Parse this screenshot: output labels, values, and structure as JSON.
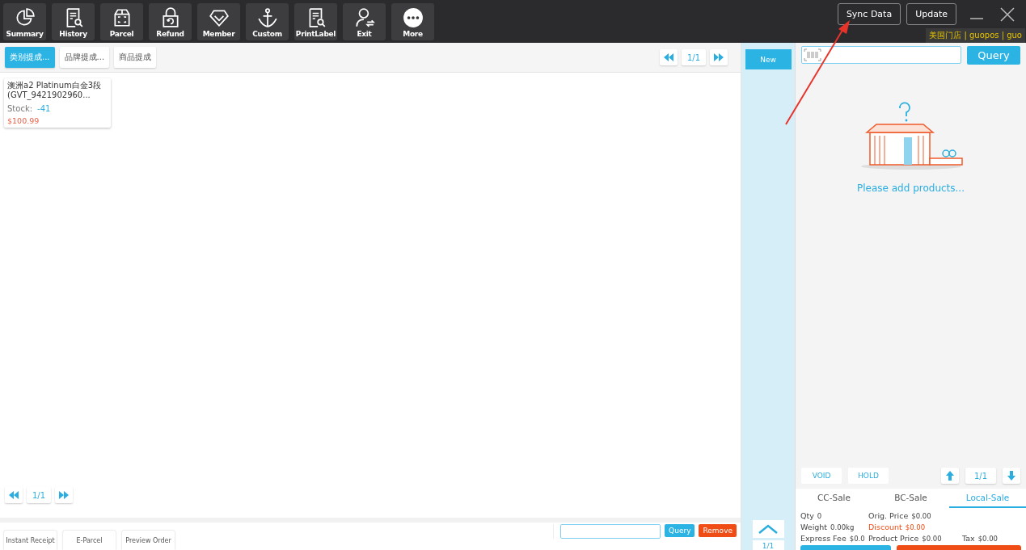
{
  "toolbar": [
    "Summary",
    "History",
    "Parcel",
    "Refund",
    "Member",
    "Custom",
    "PrintLabel",
    "Exit",
    "More"
  ],
  "header_buttons": [
    "Sync Data",
    "Update"
  ],
  "store_info": "美国门店 | guopos | guo",
  "category_tabs": [
    {
      "label": "类别提成...",
      "selected": true
    },
    {
      "label": "品牌提成...",
      "selected": false
    },
    {
      "label": "商品提成",
      "selected": false
    }
  ],
  "top_pager": "1/1",
  "products": [
    {
      "name": "澳洲a2 Platinum白金3段(GVT_9421902960...",
      "stock_label": "Stock:",
      "stock": "-41",
      "price": "$100.99"
    }
  ],
  "bottom_pager": "1/1",
  "bottom_buttons": [
    "Instant Receipt",
    "E-Parcel",
    "Preview Order"
  ],
  "order_search": {
    "query": "Query",
    "remove": "Remove"
  },
  "new_button": "New",
  "side_pager": "1/1",
  "cart": {
    "search_button": "Query",
    "empty_message": "Please add products...",
    "void": "VOID",
    "hold": "HOLD",
    "pager": "1/1"
  },
  "sale_tabs": [
    {
      "label": "CC-Sale",
      "selected": false
    },
    {
      "label": "BC-Sale",
      "selected": false
    },
    {
      "label": "Local-Sale",
      "selected": true
    }
  ],
  "totals": [
    [
      {
        "label": "Qty",
        "value": "0",
        "kind": "plain"
      },
      {
        "label": "Orig. Price",
        "value": "$0.00",
        "kind": "plain"
      }
    ],
    [
      {
        "label": "Weight",
        "value": "0.00kg",
        "kind": "plain"
      },
      {
        "label": "Discount",
        "value": "$0.00",
        "kind": "alert"
      }
    ],
    [
      {
        "label": "Express Fee",
        "value": "$0.0",
        "kind": "plain"
      },
      {
        "label": "Product Price",
        "value": "$0.00",
        "kind": "plain"
      },
      {
        "label": "Tax",
        "value": "$0.00",
        "kind": "plain"
      }
    ]
  ]
}
